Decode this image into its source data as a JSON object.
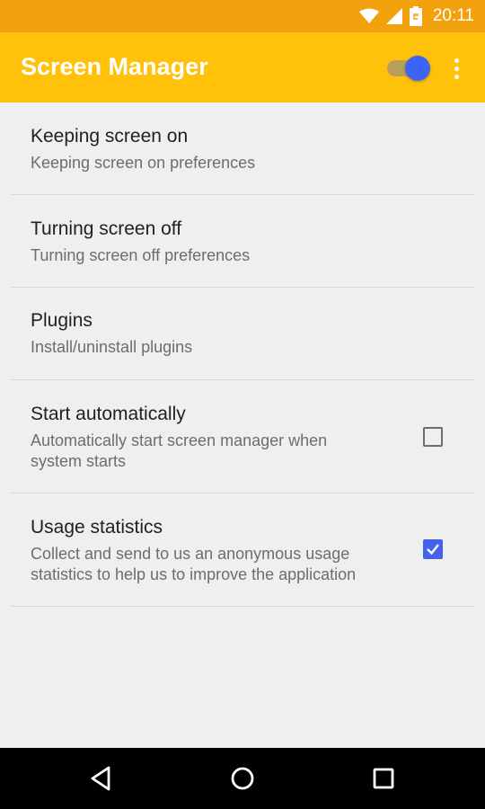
{
  "status_bar": {
    "time": "20:11",
    "icons": [
      "wifi-icon",
      "cell-signal-icon",
      "battery-icon"
    ]
  },
  "app_bar": {
    "title": "Screen Manager",
    "toggle_on": true,
    "overflow_icon": "overflow-menu-icon"
  },
  "colors": {
    "status_bar": "#f3a10c",
    "app_bar": "#ffc10a",
    "accent": "#4462ee",
    "background": "#efefef"
  },
  "preferences": [
    {
      "title": "Keeping screen on",
      "summary": "Keeping screen on preferences"
    },
    {
      "title": "Turning screen off",
      "summary": "Turning screen off preferences"
    },
    {
      "title": "Plugins",
      "summary": "Install/uninstall plugins"
    },
    {
      "title": "Start automatically",
      "summary_line1": "Automatically start screen manager when",
      "summary_line2": "system starts",
      "checked": false
    },
    {
      "title": "Usage statistics",
      "summary_line1": "Collect and send to us an anonymous usage",
      "summary_line2": "statistics to help us to improve the application",
      "checked": true
    }
  ],
  "nav_bar": {
    "icons": [
      "back-icon",
      "home-icon",
      "recents-icon"
    ]
  }
}
